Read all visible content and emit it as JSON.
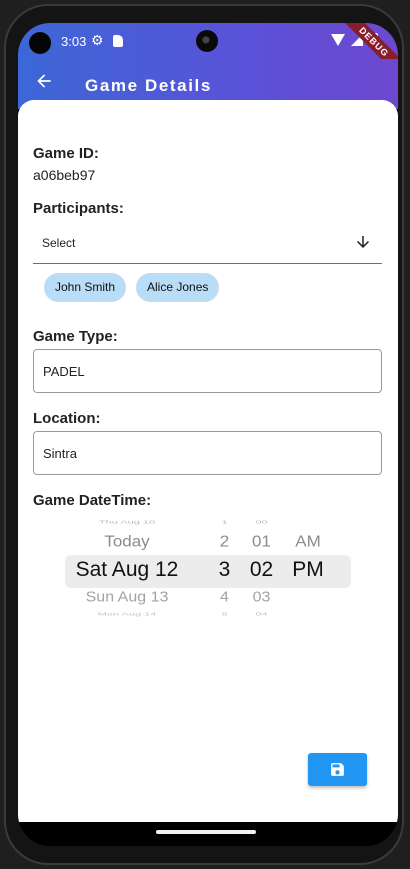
{
  "status_bar": {
    "time": "3:03",
    "debug_label": "DEBUG",
    "icons": [
      "settings-icon",
      "sd-card-icon",
      "wifi-icon",
      "signal-icon",
      "battery-icon"
    ]
  },
  "app_bar": {
    "title": "Game Details",
    "back_icon": "arrow-left-icon"
  },
  "game_id": {
    "label": "Game ID:",
    "value": "a06beb97"
  },
  "participants": {
    "label": "Participants:",
    "placeholder": "Select",
    "dropdown_icon": "arrow-down-icon",
    "selected": [
      "John Smith",
      "Alice Jones"
    ]
  },
  "game_type": {
    "label": "Game Type:",
    "value": "PADEL"
  },
  "location": {
    "label": "Location:",
    "value": "Sintra"
  },
  "game_datetime": {
    "label": "Game DateTime:",
    "rows": [
      {
        "date": "Thu Aug 10",
        "hour": "1",
        "minute": "00",
        "ampm": ""
      },
      {
        "date": "Today",
        "hour": "2",
        "minute": "01",
        "ampm": "AM"
      },
      {
        "date": "Sat Aug 12",
        "hour": "3",
        "minute": "02",
        "ampm": "PM"
      },
      {
        "date": "Sun Aug 13",
        "hour": "4",
        "minute": "03",
        "ampm": ""
      },
      {
        "date": "Mon Aug 14",
        "hour": "5",
        "minute": "04",
        "ampm": ""
      }
    ]
  },
  "save_button": {
    "icon": "save-icon"
  },
  "colors": {
    "app_bar_start": "#3c67d6",
    "app_bar_end": "#6d48cf",
    "chip_background": "#b9dcf7",
    "save_button": "#2196f3",
    "dropdown_underline": "#3b73d6"
  }
}
